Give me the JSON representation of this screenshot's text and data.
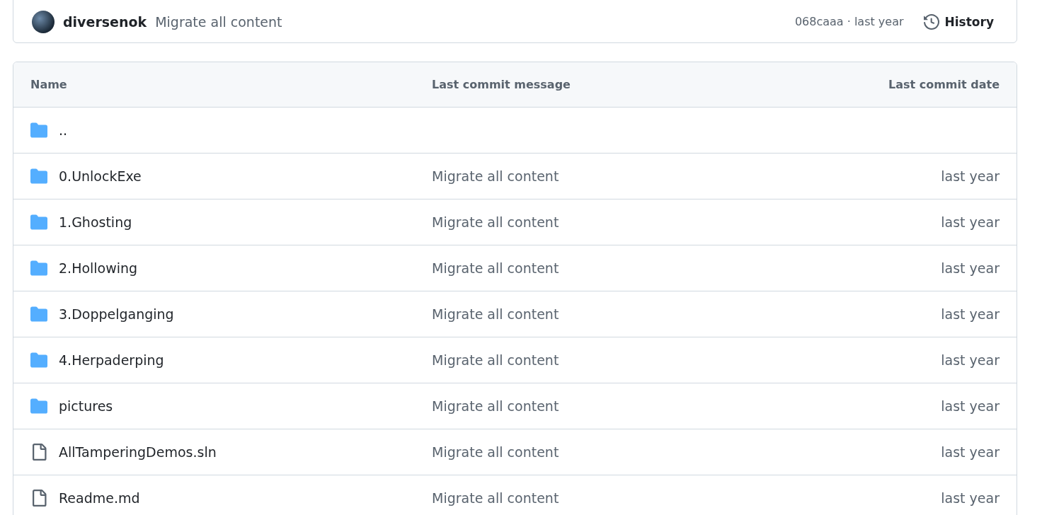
{
  "commit_bar": {
    "author": "diversenok",
    "message": "Migrate all content",
    "hash_and_time": "068caaa · last year",
    "history_label": "History"
  },
  "table": {
    "columns": [
      "Name",
      "Last commit message",
      "Last commit date"
    ],
    "rows": [
      {
        "kind": "folder",
        "name": ".."
      },
      {
        "kind": "folder",
        "name": "0.UnlockExe",
        "message": "Migrate all content",
        "date": "last year"
      },
      {
        "kind": "folder",
        "name": "1.Ghosting",
        "message": "Migrate all content",
        "date": "last year"
      },
      {
        "kind": "folder",
        "name": "2.Hollowing",
        "message": "Migrate all content",
        "date": "last year"
      },
      {
        "kind": "folder",
        "name": "3.Doppelganging",
        "message": "Migrate all content",
        "date": "last year"
      },
      {
        "kind": "folder",
        "name": "4.Herpaderping",
        "message": "Migrate all content",
        "date": "last year"
      },
      {
        "kind": "folder",
        "name": "pictures",
        "message": "Migrate all content",
        "date": "last year"
      },
      {
        "kind": "file",
        "name": "AllTamperingDemos.sln",
        "message": "Migrate all content",
        "date": "last year"
      },
      {
        "kind": "file",
        "name": "Readme.md",
        "message": "Migrate all content",
        "date": "last year"
      }
    ]
  }
}
